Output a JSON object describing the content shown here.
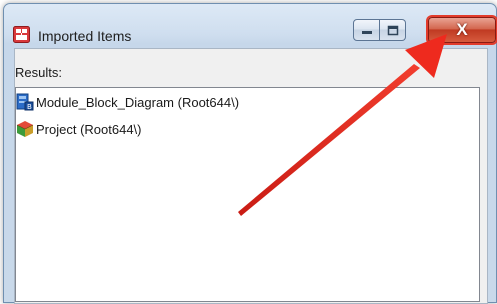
{
  "window": {
    "title": "Imported Items",
    "controls": {
      "minimize": "minimize",
      "maximize": "maximize",
      "close": "X"
    }
  },
  "results": {
    "label": "Results:",
    "items": [
      {
        "label": "Module_Block_Diagram (Root644\\)",
        "icon": "block-diagram-icon"
      },
      {
        "label": "Project (Root644\\)",
        "icon": "project-cube-icon"
      }
    ]
  },
  "annotation": {
    "arrow_color": "#e8211a",
    "highlight_color": "#e23c2c"
  }
}
